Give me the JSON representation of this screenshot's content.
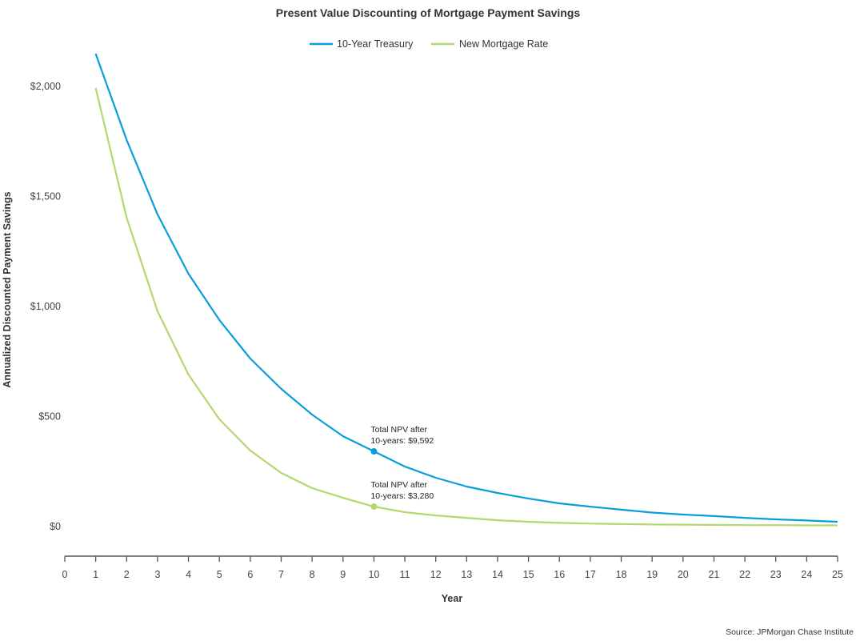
{
  "chart_data": {
    "type": "line",
    "title": "Present Value Discounting of Mortgage Payment Savings",
    "xlabel": "Year",
    "ylabel": "Annualized Discounted Payment Savings",
    "xlim": [
      0,
      25
    ],
    "ylim": [
      -130,
      2200
    ],
    "x_ticks": [
      0,
      1,
      2,
      3,
      4,
      5,
      6,
      7,
      8,
      9,
      10,
      11,
      12,
      13,
      14,
      15,
      16,
      17,
      18,
      19,
      20,
      21,
      22,
      23,
      24,
      25
    ],
    "y_ticks": [
      0,
      500,
      1000,
      1500,
      2000
    ],
    "y_tick_labels": [
      "$0",
      "$500",
      "$1,000",
      "$1,500",
      "$2,000"
    ],
    "grid": false,
    "legend_position": "top-center",
    "x": [
      1,
      2,
      3,
      4,
      5,
      6,
      7,
      8,
      9,
      10,
      11,
      12,
      13,
      14,
      15,
      16,
      17,
      18,
      19,
      20,
      21,
      22,
      23,
      24,
      25
    ],
    "series": [
      {
        "name": "10-Year Treasury",
        "color": "#0a9ddb",
        "values": [
          2145,
          1753,
          1415,
          1145,
          935,
          760,
          622,
          505,
          407,
          338,
          269,
          218,
          178,
          149,
          124,
          102,
          87,
          73,
          60,
          51,
          44,
          36,
          29,
          24,
          18
        ]
      },
      {
        "name": "New Mortgage Rate",
        "color": "#b2d86e",
        "values": [
          1989,
          1400,
          975,
          687,
          484,
          342,
          240,
          171,
          127,
          87,
          62,
          47,
          36,
          25,
          18,
          13,
          10,
          8,
          6,
          5,
          4,
          3,
          3,
          2,
          2
        ]
      }
    ],
    "annotations": [
      {
        "series": 0,
        "x": 10,
        "line1": "Total NPV after",
        "line2": "10-years: $9,592"
      },
      {
        "series": 1,
        "x": 10,
        "line1": "Total NPV after",
        "line2": "10-years: $3,280"
      }
    ],
    "source": "Source: JPMorgan Chase Institute"
  }
}
